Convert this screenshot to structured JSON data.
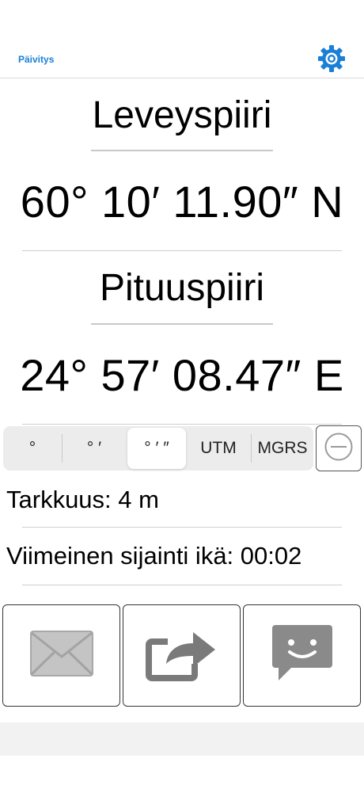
{
  "header": {
    "refresh_label": "Päivitys",
    "settings_icon": "gear-icon",
    "accent_color": "#1a7fd6"
  },
  "latitude": {
    "label": "Leveyspiiri",
    "value": "60° 10′ 11.90″ N"
  },
  "longitude": {
    "label": "Pituuspiiri",
    "value": "24° 57′ 08.47″ E"
  },
  "format_selector": {
    "options": [
      "°",
      "° ′",
      "° ′ ″",
      "UTM",
      "MGRS"
    ],
    "selected": "° ′ ″",
    "minus_icon": "minus-circle-icon"
  },
  "status": {
    "accuracy": "Tarkkuus: 4 m",
    "last_location_age": "Viimeinen sijainti ikä: 00:02"
  },
  "share_buttons": [
    {
      "icon": "mail-icon"
    },
    {
      "icon": "share-arrow-icon"
    },
    {
      "icon": "message-icon"
    }
  ]
}
